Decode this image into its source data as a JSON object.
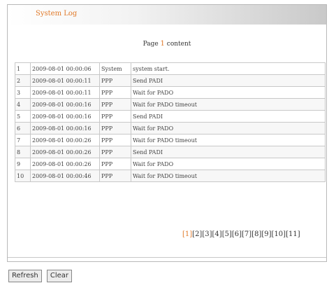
{
  "panel": {
    "title": "System Log",
    "page_prefix": "Page",
    "page_num": "1",
    "page_suffix": "content"
  },
  "log": {
    "rows": [
      {
        "idx": "1",
        "time": "2009-08-01 00:00:06",
        "module": "System",
        "msg": "system start."
      },
      {
        "idx": "2",
        "time": "2009-08-01 00:00:11",
        "module": "PPP",
        "msg": "Send PADI"
      },
      {
        "idx": "3",
        "time": "2009-08-01 00:00:11",
        "module": "PPP",
        "msg": "Wait for PADO"
      },
      {
        "idx": "4",
        "time": "2009-08-01 00:00:16",
        "module": "PPP",
        "msg": "Wait for PADO timeout"
      },
      {
        "idx": "5",
        "time": "2009-08-01 00:00:16",
        "module": "PPP",
        "msg": "Send PADI"
      },
      {
        "idx": "6",
        "time": "2009-08-01 00:00:16",
        "module": "PPP",
        "msg": "Wait for PADO"
      },
      {
        "idx": "7",
        "time": "2009-08-01 00:00:26",
        "module": "PPP",
        "msg": "Wait for PADO timeout"
      },
      {
        "idx": "8",
        "time": "2009-08-01 00:00:26",
        "module": "PPP",
        "msg": "Send PADI"
      },
      {
        "idx": "9",
        "time": "2009-08-01 00:00:26",
        "module": "PPP",
        "msg": "Wait for PADO"
      },
      {
        "idx": "10",
        "time": "2009-08-01 00:00:46",
        "module": "PPP",
        "msg": "Wait for PADO timeout"
      }
    ]
  },
  "pager": {
    "pages": [
      "[1]",
      "[2]",
      "[3]",
      "[4]",
      "[5]",
      "[6]",
      "[7]",
      "[8]",
      "[9]",
      "[10]",
      "[11]"
    ],
    "current": "[1]"
  },
  "buttons": {
    "refresh": "Refresh",
    "clear": "Clear"
  },
  "colors": {
    "accent": "#e07a2a",
    "border": "#c8c8c8"
  }
}
